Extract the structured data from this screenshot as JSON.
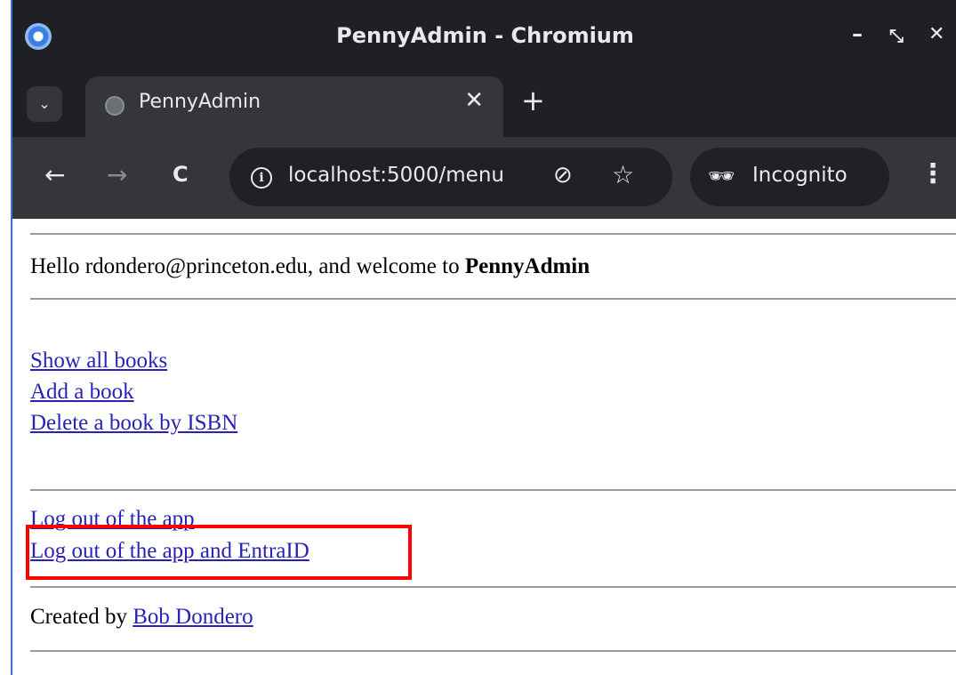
{
  "window": {
    "title": "PennyAdmin - Chromium",
    "minimize_glyph": "–",
    "maximize_glyph": "⤡",
    "close_glyph": "✕"
  },
  "tabs": [
    {
      "label": "PennyAdmin",
      "close_glyph": "✕"
    }
  ],
  "tab_search_glyph": "⌄",
  "new_tab_glyph": "+",
  "toolbar": {
    "back_glyph": "←",
    "forward_glyph": "→",
    "reload_glyph": "C",
    "url": "localhost:5000/menu",
    "eye_glyph": "⊘",
    "star_glyph": "☆",
    "incognito_label": "Incognito",
    "incognito_glyph": "🕶",
    "menu_glyph": "⋮"
  },
  "page": {
    "greeting_prefix": "Hello rdondero@princeton.edu, and welcome to ",
    "app_name": "PennyAdmin",
    "links": [
      "Show all books",
      "Add a book",
      "Delete a book by ISBN"
    ],
    "logout_links": [
      "Log out of the app",
      "Log out of the app and EntraID"
    ],
    "footer_prefix": "Created by ",
    "footer_link": "Bob Dondero"
  },
  "colors": {
    "highlight": "#ff0000",
    "link": "#2a22b8",
    "chrome_dark": "#1f2023",
    "chrome_toolbar": "#35363a"
  }
}
